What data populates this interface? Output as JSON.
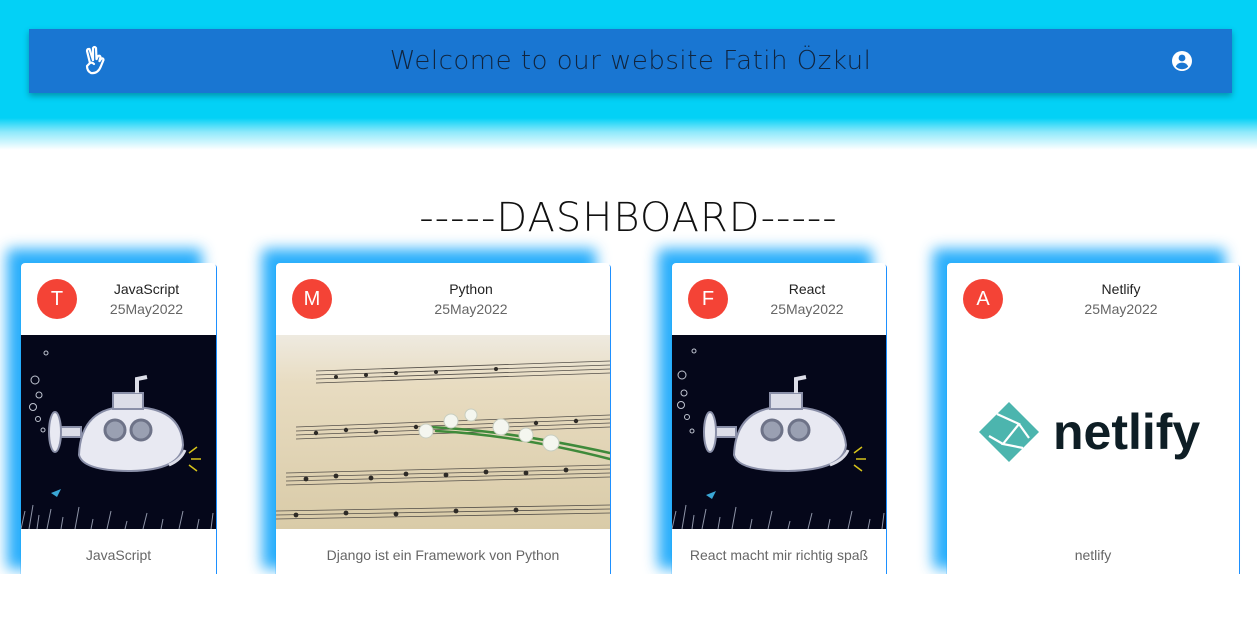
{
  "appbar": {
    "title": "Welcome to our website Fatih Özkul",
    "menu_icon": "peace-hand-icon",
    "account_icon": "account-circle-icon"
  },
  "dashboard": {
    "title": "-----DASHBOARD-----"
  },
  "colors": {
    "band": "#03d1f6",
    "appbar": "#1976d2",
    "avatar": "#f44336",
    "card_glow": "#03a0fa"
  },
  "cards": [
    {
      "avatar": "T",
      "title": "JavaScript",
      "date": "25May2022",
      "image": "submarine-illustration",
      "description": "JavaScript"
    },
    {
      "avatar": "M",
      "title": "Python",
      "date": "25May2022",
      "image": "sheet-music-photo",
      "description": "Django ist ein Framework von Python"
    },
    {
      "avatar": "F",
      "title": "React",
      "date": "25May2022",
      "image": "submarine-illustration",
      "description": "React macht mir richtig spaß"
    },
    {
      "avatar": "A",
      "title": "Netlify",
      "date": "25May2022",
      "image": "netlify-logo",
      "logo_text": "netlify",
      "description": "netlify"
    }
  ]
}
